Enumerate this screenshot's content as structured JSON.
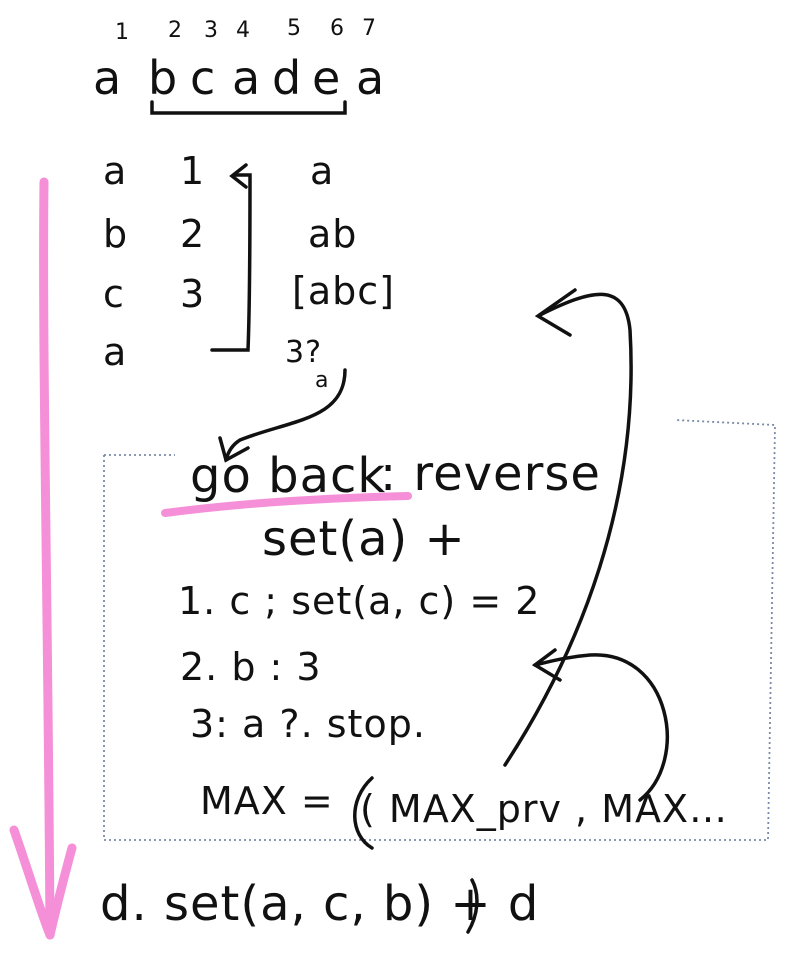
{
  "colors": {
    "ink": "#111111",
    "highlight": "#f48fd8",
    "box_dots": "#7a8aa8"
  },
  "top": {
    "indices": [
      "1",
      "2",
      "3",
      "4",
      "5",
      "6",
      "7"
    ],
    "letters": [
      "a",
      "b",
      "c",
      "a",
      "d",
      "e",
      "a"
    ]
  },
  "table": {
    "rows": [
      {
        "char": "a",
        "num": "1",
        "set": "a"
      },
      {
        "char": "b",
        "num": "2",
        "set": "ab"
      },
      {
        "char": "c",
        "num": "3",
        "set": "[abc]"
      },
      {
        "char": "a",
        "num": "",
        "set": ""
      }
    ],
    "cmp_top": "3?",
    "cmp_bottom": "a"
  },
  "box": {
    "heading_underlined": "go back",
    "heading_rest": ": reverse",
    "line2": "set(a) +",
    "steps": [
      "1. c ; set(a, c) = 2",
      "2. b :    3",
      "3: a ?.  stop."
    ],
    "max_lhs": "MAX =",
    "max_rhs": "( MAX_prv , MAX…"
  },
  "bottom": {
    "line": "d.  set(a, c, b) + d"
  }
}
